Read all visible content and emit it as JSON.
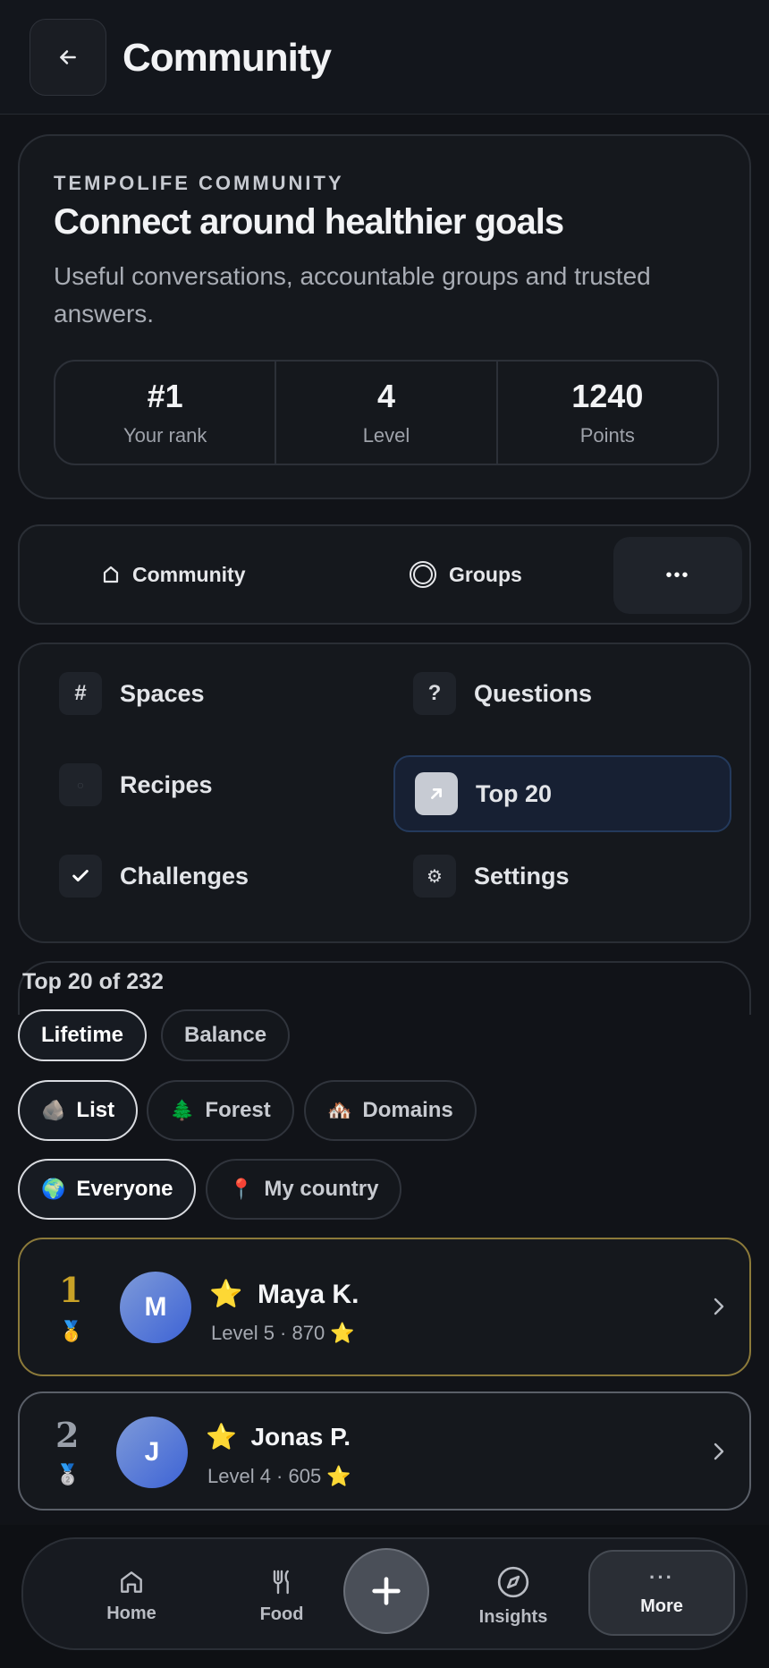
{
  "header": {
    "title": "Community"
  },
  "hero": {
    "eyebrow": "TEMPOLIFE COMMUNITY",
    "title": "Connect around healthier goals",
    "subtitle": "Useful conversations, accountable groups and trusted answers.",
    "stats": [
      {
        "value": "#1",
        "label": "Your rank"
      },
      {
        "value": "4",
        "label": "Level"
      },
      {
        "value": "1240",
        "label": "Points"
      }
    ]
  },
  "tabs": {
    "community": "Community",
    "groups": "Groups",
    "more": "•••"
  },
  "menu": {
    "spaces": {
      "icon": "#",
      "label": "Spaces"
    },
    "questions": {
      "icon": "?",
      "label": "Questions"
    },
    "recipes": {
      "icon": "○",
      "label": "Recipes"
    },
    "top20": {
      "label": "Top 20"
    },
    "challenges": {
      "label": "Challenges"
    },
    "settings": {
      "icon": "⚙",
      "label": "Settings"
    }
  },
  "leaderboard": {
    "title": "Top 20 of 232",
    "period_chips": [
      "Lifetime",
      "Balance"
    ],
    "view_chips": [
      {
        "emoji": "🪨",
        "label": "List"
      },
      {
        "emoji": "🌲",
        "label": "Forest"
      },
      {
        "emoji": "🏘️",
        "label": "Domains"
      }
    ],
    "scope_chips": [
      {
        "emoji": "🌍",
        "label": "Everyone"
      },
      {
        "emoji": "📍",
        "label": "My country"
      }
    ],
    "rows": [
      {
        "rank": "1",
        "medal": "🥇",
        "initial": "M",
        "star": "⭐",
        "name": "Maya K.",
        "meta": "Level 5 · 870 ⭐"
      },
      {
        "rank": "2",
        "medal": "🥈",
        "initial": "J",
        "star": "⭐",
        "name": "Jonas P.",
        "meta": "Level 4 · 605 ⭐"
      }
    ]
  },
  "bottom_nav": {
    "home": "Home",
    "food": "Food",
    "insights": "Insights",
    "more": "More",
    "more_icon": "···"
  },
  "colors": {
    "gold_rank": "#c9a227",
    "silver_rank": "#9aa0aa",
    "active_blue": "#172033"
  }
}
